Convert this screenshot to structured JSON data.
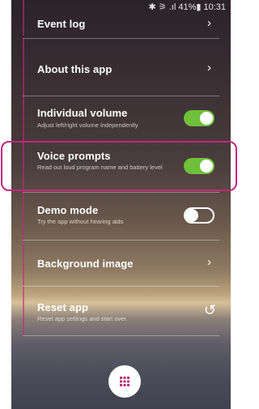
{
  "status_bar": {
    "text": "✱ ⚞ .ıl 41%▮ 10:31"
  },
  "menu": {
    "event_log": {
      "label": "Event log"
    },
    "about": {
      "label": "About this app"
    },
    "individual_volume": {
      "label": "Individual volume",
      "description": "Adjust left/right volume independently",
      "enabled": true
    },
    "voice_prompts": {
      "label": "Voice prompts",
      "description": "Read out loud program name and battery level",
      "enabled": true
    },
    "demo_mode": {
      "label": "Demo mode",
      "description": "Try the app without hearing aids",
      "enabled": false
    },
    "background_image": {
      "label": "Background image"
    },
    "reset_app": {
      "label": "Reset app",
      "description": "Reset app settings and start over"
    }
  },
  "icons": {
    "chevron": "chevron-right-icon",
    "reset": "refresh-icon",
    "menu_fab": "grid-icon"
  },
  "colors": {
    "accent": "#c2287a",
    "toggle_on": "#6fbf3a"
  }
}
